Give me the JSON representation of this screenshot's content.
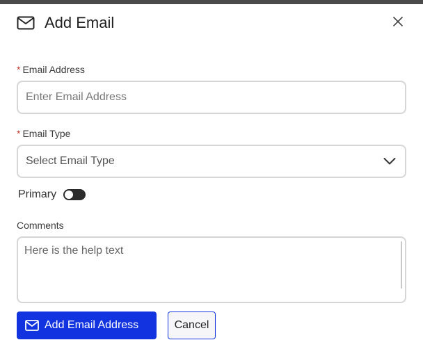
{
  "dialog": {
    "title": "Add Email",
    "title_icon": "mail-icon",
    "close_icon": "close-icon"
  },
  "form": {
    "email_address": {
      "required_mark": "*",
      "label": "Email Address",
      "value": "",
      "placeholder": "Enter Email Address"
    },
    "email_type": {
      "required_mark": "*",
      "label": "Email Type",
      "selected": "Select Email Type",
      "icon": "chevron-down-icon"
    },
    "primary": {
      "label": "Primary",
      "checked": false
    },
    "comments": {
      "label": "Comments",
      "value": "",
      "placeholder": "Here is the help text"
    }
  },
  "actions": {
    "submit_label": "Add Email Address",
    "submit_icon": "mail-icon",
    "cancel_label": "Cancel"
  },
  "colors": {
    "primary": "#1133e0",
    "required": "#c0392b",
    "toggle_off": "#2b2b2b",
    "border": "#d6d6d6"
  }
}
